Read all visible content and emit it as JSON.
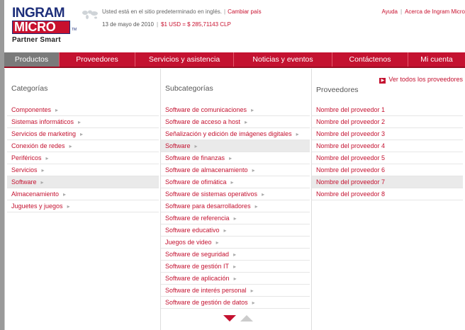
{
  "header": {
    "logo_line1": "INGRAM",
    "logo_line2": "MICRO",
    "logo_tm": "TM",
    "logo_tagline": "Partner Smart",
    "locale_text": "Usted está en el sitio predeterminado en inglés.",
    "change_country": "Cambiar país",
    "date": "13 de mayo de 2010",
    "exchange_rate": "$1 USD = $ 285,71143 CLP",
    "help": "Ayuda",
    "about": "Acerca de Ingram Micro"
  },
  "nav": [
    {
      "label": "Productos",
      "active": true
    },
    {
      "label": "Proveedores",
      "active": false
    },
    {
      "label": "Servicios y asistencia",
      "active": false
    },
    {
      "label": "Noticias y eventos",
      "active": false
    },
    {
      "label": "Contáctenos",
      "active": false
    },
    {
      "label": "Mi cuenta",
      "active": false
    }
  ],
  "categories": {
    "title": "Categorías",
    "items": [
      {
        "label": "Componentes",
        "selected": false
      },
      {
        "label": "Sistemas informáticos",
        "selected": false
      },
      {
        "label": "Servicios de marketing",
        "selected": false
      },
      {
        "label": "Conexión de redes",
        "selected": false
      },
      {
        "label": "Periféricos",
        "selected": false
      },
      {
        "label": "Servicios",
        "selected": false
      },
      {
        "label": "Software",
        "selected": true
      },
      {
        "label": "Almacenamiento",
        "selected": false
      },
      {
        "label": "Juguetes y juegos",
        "selected": false
      }
    ]
  },
  "subcategories": {
    "title": "Subcategorías",
    "items": [
      {
        "label": "Software de comunicaciones",
        "selected": false
      },
      {
        "label": "Software de acceso a host",
        "selected": false
      },
      {
        "label": "Señalización y edición de imágenes digitales",
        "selected": false
      },
      {
        "label": "Software",
        "selected": true
      },
      {
        "label": "Software de finanzas",
        "selected": false
      },
      {
        "label": "Software de almacenamiento",
        "selected": false
      },
      {
        "label": "Software de ofimática",
        "selected": false
      },
      {
        "label": "Software de sistemas operativos",
        "selected": false
      },
      {
        "label": "Software para desarrolladores",
        "selected": false
      },
      {
        "label": "Software de referencia",
        "selected": false
      },
      {
        "label": "Software educativo",
        "selected": false
      },
      {
        "label": "Juegos de video",
        "selected": false
      },
      {
        "label": "Software de seguridad",
        "selected": false
      },
      {
        "label": "Software de gestión IT",
        "selected": false
      },
      {
        "label": "Software de aplicación",
        "selected": false
      },
      {
        "label": "Software de interés personal",
        "selected": false
      },
      {
        "label": "Software de gestión de datos",
        "selected": false
      }
    ]
  },
  "providers": {
    "title": "Proveedores",
    "view_all": "Ver todos los proveedores",
    "items": [
      {
        "label": "Nombre del proveedor 1",
        "selected": false
      },
      {
        "label": "Nombre del proveedor 2",
        "selected": false
      },
      {
        "label": "Nombre del proveedor 3",
        "selected": false
      },
      {
        "label": "Nombre del proveedor 4",
        "selected": false
      },
      {
        "label": "Nombre del proveedor 5",
        "selected": false
      },
      {
        "label": "Nombre del proveedor 6",
        "selected": false
      },
      {
        "label": "Nombre del proveedor 7",
        "selected": true
      },
      {
        "label": "Nombre del proveedor 8",
        "selected": false
      }
    ]
  },
  "icons": {
    "chevron": "chevron-right-icon",
    "globe": "globe-icon",
    "scroll_down": "scroll-down-icon",
    "scroll_up": "scroll-up-icon"
  },
  "colors": {
    "brand_red": "#c41230",
    "brand_blue": "#1d2e7a",
    "nav_active": "#7a7a7a",
    "selected_row": "#eaeaea"
  }
}
